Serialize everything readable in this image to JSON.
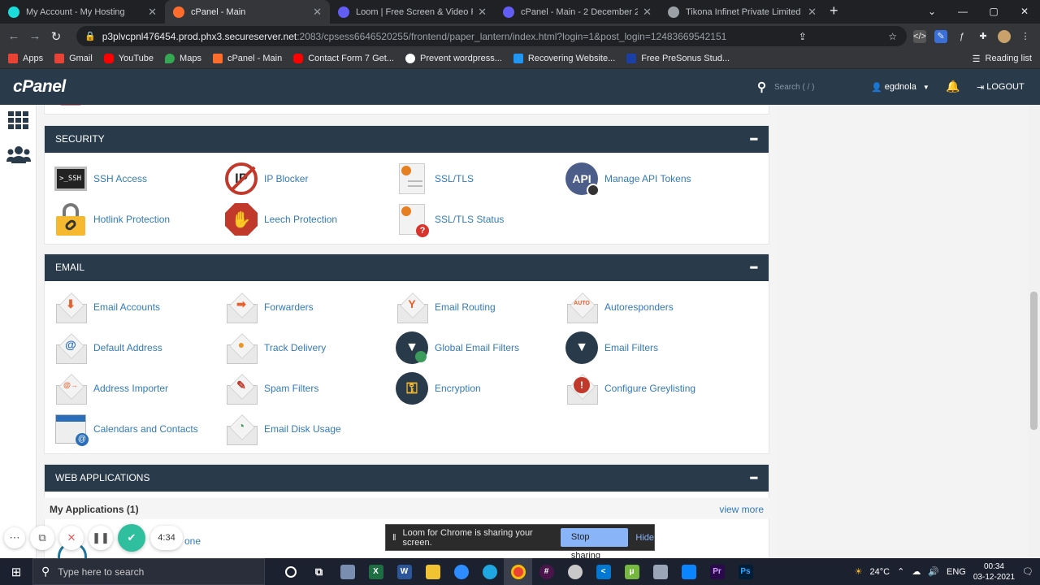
{
  "browser": {
    "tabs": [
      {
        "title": "My Account - My Hosting",
        "color": "#1bdbdb",
        "active": false
      },
      {
        "title": "cPanel - Main",
        "color": "#ff6c2c",
        "active": true
      },
      {
        "title": "Loom | Free Screen & Video Rec",
        "color": "#625df5",
        "active": false
      },
      {
        "title": "cPanel - Main - 2 December 202",
        "color": "#625df5",
        "active": false
      },
      {
        "title": "Tikona Infinet Private Limited",
        "color": "#9aa0a6",
        "active": false
      }
    ],
    "url_host": "p3plvcpnl476454.prod.phx3.secureserver.net",
    "url_rest": ":2083/cpsess6646520255/frontend/paper_lantern/index.html?login=1&post_login=12483669542151",
    "bookmarks": [
      {
        "label": "Apps",
        "color": "#ea4335"
      },
      {
        "label": "Gmail",
        "color": "#ea4335"
      },
      {
        "label": "YouTube",
        "color": "#ff0000"
      },
      {
        "label": "Maps",
        "color": "#34a853"
      },
      {
        "label": "cPanel - Main",
        "color": "#ff6c2c"
      },
      {
        "label": "Contact Form 7 Get...",
        "color": "#ff0000"
      },
      {
        "label": "Prevent wordpress...",
        "color": "#ffffff"
      },
      {
        "label": "Recovering Website...",
        "color": "#2196f3"
      },
      {
        "label": "Free PreSonus Stud...",
        "color": "#1a3fa6"
      }
    ],
    "reading_list": "Reading list"
  },
  "cpanel": {
    "logo": "cPanel",
    "search_placeholder": "Search ( / )",
    "username": "egdnola",
    "logout": "LOGOUT"
  },
  "sections": {
    "security": {
      "title": "SECURITY",
      "items": [
        {
          "label": "SSH Access",
          "icon": "ssh-terminal-icon"
        },
        {
          "label": "IP Blocker",
          "icon": "ip-blocker-icon"
        },
        {
          "label": "SSL/TLS",
          "icon": "certificate-icon"
        },
        {
          "label": "Manage API Tokens",
          "icon": "api-token-icon"
        },
        {
          "label": "Hotlink Protection",
          "icon": "padlock-link-icon"
        },
        {
          "label": "Leech Protection",
          "icon": "stop-hand-icon"
        },
        {
          "label": "SSL/TLS Status",
          "icon": "certificate-status-icon"
        }
      ]
    },
    "email": {
      "title": "EMAIL",
      "items": [
        {
          "label": "Email Accounts",
          "icon": "email-accounts-icon"
        },
        {
          "label": "Forwarders",
          "icon": "email-forward-icon"
        },
        {
          "label": "Email Routing",
          "icon": "email-routing-icon"
        },
        {
          "label": "Autoresponders",
          "icon": "autoresponder-icon"
        },
        {
          "label": "Default Address",
          "icon": "default-address-icon"
        },
        {
          "label": "Track Delivery",
          "icon": "track-delivery-icon"
        },
        {
          "label": "Global Email Filters",
          "icon": "global-filter-icon"
        },
        {
          "label": "Email Filters",
          "icon": "email-filter-icon"
        },
        {
          "label": "Address Importer",
          "icon": "address-importer-icon"
        },
        {
          "label": "Spam Filters",
          "icon": "spam-filter-icon"
        },
        {
          "label": "Encryption",
          "icon": "encryption-key-icon"
        },
        {
          "label": "Configure Greylisting",
          "icon": "greylisting-icon"
        },
        {
          "label": "Calendars and Contacts",
          "icon": "calendar-icon"
        },
        {
          "label": "Email Disk Usage",
          "icon": "disk-usage-icon"
        }
      ]
    },
    "web_apps": {
      "title": "WEB APPLICATIONS",
      "my_apps": "My Applications (1)",
      "view_more": "view more",
      "partial_item": "one"
    }
  },
  "loom": {
    "timer": "4:34",
    "share_text": "Loom for Chrome is sharing your screen.",
    "stop": "Stop sharing",
    "hide": "Hide"
  },
  "taskbar": {
    "search": "Type here to search",
    "temp": "24°C",
    "lang": "ENG",
    "time": "00:34",
    "date": "03-12-2021"
  }
}
